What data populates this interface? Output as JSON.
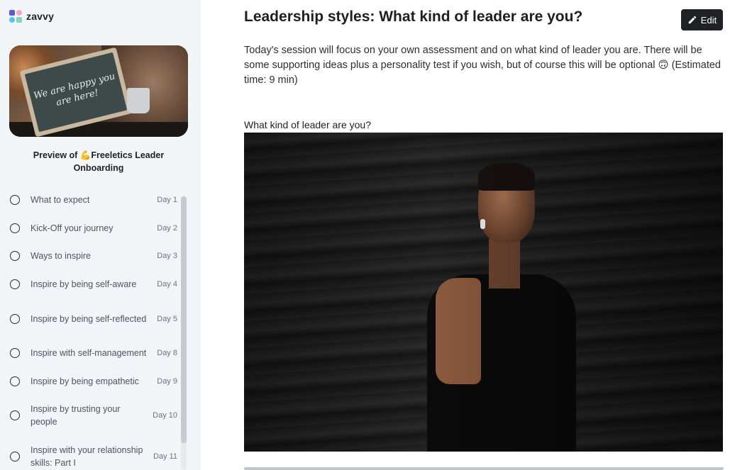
{
  "app": {
    "logo_text": "zavvy"
  },
  "sidebar": {
    "hero_image_text": "We are happy you are here!",
    "course_title": "Preview of 💪Freeletics Leader Onboarding",
    "lessons": [
      {
        "label": "What to expect",
        "day": "Day 1"
      },
      {
        "label": "Kick-Off your journey",
        "day": "Day 2"
      },
      {
        "label": "Ways to inspire",
        "day": "Day 3"
      },
      {
        "label": "Inspire by being self-aware",
        "day": "Day 4"
      },
      {
        "label": "Inspire by being self-reflected",
        "day": "Day 5"
      },
      {
        "label": "Inspire with self-management",
        "day": "Day 8"
      },
      {
        "label": "Inspire by being empathetic",
        "day": "Day 9"
      },
      {
        "label": "Inspire by trusting your people",
        "day": "Day 10"
      },
      {
        "label": "Inspire with your relationship skills: Part I",
        "day": "Day 11"
      }
    ]
  },
  "main": {
    "title": "Leadership styles: What kind of leader are you?",
    "edit_label": "Edit",
    "intro": "Today's session will focus on your own assessment and on what kind of leader you are. There will be some supporting ideas plus a personality test if you wish, but of course this will be optional 🙃 (Estimated time: 9 min)",
    "section_heading": "What kind of leader are you?"
  },
  "colors": {
    "sidebar_bg": "#f2f5f8",
    "edit_button_bg": "#1f2124",
    "lesson_text": "#4c5461"
  }
}
